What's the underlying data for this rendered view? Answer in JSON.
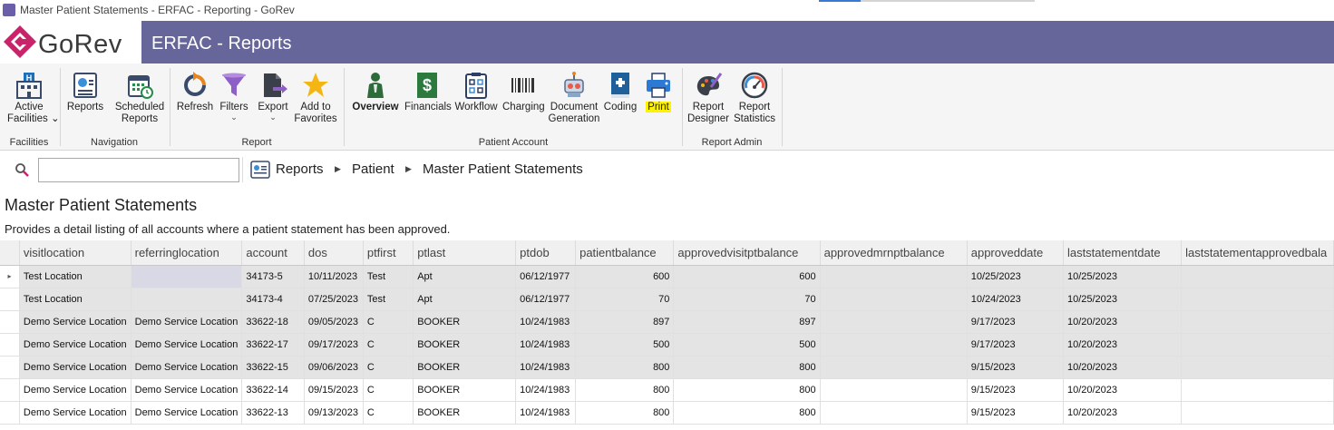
{
  "window": {
    "title": "Master Patient Statements - ERFAC - Reporting - GoRev"
  },
  "brand": {
    "logo_text": "GoRev",
    "header_title": "ERFAC - Reports",
    "header_color": "#67669a",
    "logo_color": "#c8246a"
  },
  "ribbon": {
    "groups": [
      {
        "label": "Facilities"
      },
      {
        "label": "Navigation"
      },
      {
        "label": "Report"
      },
      {
        "label": "Patient Account"
      },
      {
        "label": "Report Admin"
      }
    ],
    "buttons": {
      "active_facilities": [
        "Active",
        "Facilities"
      ],
      "reports": "Reports",
      "scheduled_reports": [
        "Scheduled",
        "Reports"
      ],
      "refresh": "Refresh",
      "filters": "Filters",
      "export": "Export",
      "add_to_favorites": [
        "Add to",
        "Favorites"
      ],
      "overview": "Overview",
      "financials": "Financials",
      "workflow": "Workflow",
      "charging": "Charging",
      "document_generation": [
        "Document",
        "Generation"
      ],
      "coding": "Coding",
      "print": "Print",
      "report_designer": [
        "Report",
        "Designer"
      ],
      "report_statistics": [
        "Report",
        "Statistics"
      ]
    }
  },
  "search": {
    "value": "",
    "placeholder": ""
  },
  "breadcrumb": [
    "Reports",
    "Patient",
    "Master Patient Statements"
  ],
  "page": {
    "title": "Master Patient Statements",
    "description": "Provides a detail listing of all accounts where a patient statement has been approved."
  },
  "grid": {
    "columns": [
      "visitlocation",
      "referringlocation",
      "account",
      "dos",
      "ptfirst",
      "ptlast",
      "ptdob",
      "patientbalance",
      "approvedvisitptbalance",
      "approvedmrnptbalance",
      "approveddate",
      "laststatementdate",
      "laststatementapprovedbala"
    ],
    "rows": [
      [
        "Test Location",
        "",
        "34173-5",
        "10/11/2023",
        "Test",
        "Apt",
        "06/12/1977",
        "600",
        "600",
        "",
        "10/25/2023",
        "10/25/2023",
        ""
      ],
      [
        "Test Location",
        "",
        "34173-4",
        "07/25/2023",
        "Test",
        "Apt",
        "06/12/1977",
        "70",
        "70",
        "",
        "10/24/2023",
        "10/25/2023",
        ""
      ],
      [
        "Demo Service Location",
        "Demo Service Location",
        "33622-18",
        "09/05/2023",
        "C",
        "BOOKER",
        "10/24/1983",
        "897",
        "897",
        "",
        "9/17/2023",
        "10/20/2023",
        ""
      ],
      [
        "Demo Service Location",
        "Demo Service Location",
        "33622-17",
        "09/17/2023",
        "C",
        "BOOKER",
        "10/24/1983",
        "500",
        "500",
        "",
        "9/17/2023",
        "10/20/2023",
        ""
      ],
      [
        "Demo Service Location",
        "Demo Service Location",
        "33622-15",
        "09/06/2023",
        "C",
        "BOOKER",
        "10/24/1983",
        "800",
        "800",
        "",
        "9/15/2023",
        "10/20/2023",
        ""
      ],
      [
        "Demo Service Location",
        "Demo Service Location",
        "33622-14",
        "09/15/2023",
        "C",
        "BOOKER",
        "10/24/1983",
        "800",
        "800",
        "",
        "9/15/2023",
        "10/20/2023",
        ""
      ],
      [
        "Demo Service Location",
        "Demo Service Location",
        "33622-13",
        "09/13/2023",
        "C",
        "BOOKER",
        "10/24/1983",
        "800",
        "800",
        "",
        "9/15/2023",
        "10/20/2023",
        ""
      ]
    ],
    "current_row_indicator": "▸"
  }
}
